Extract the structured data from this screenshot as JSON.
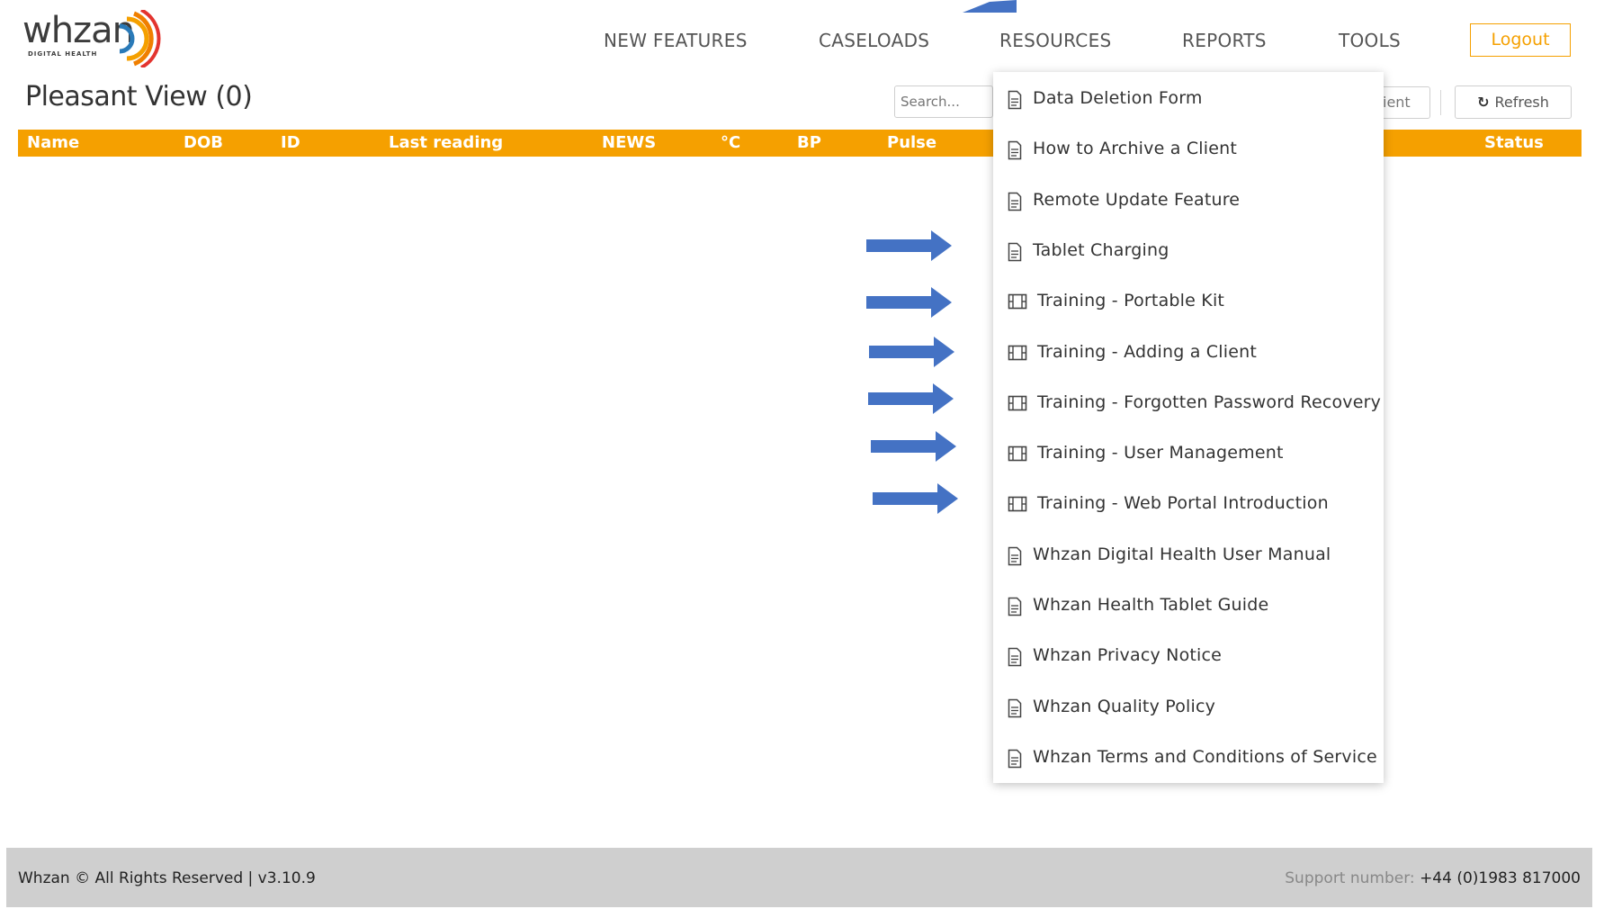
{
  "brand": {
    "name": "whzan",
    "tagline": "DIGITAL HEALTH",
    "colors": {
      "orange": "#f5a000",
      "arc_red": "#e3342f",
      "arc_amber": "#f5a000",
      "arrow_blue": "#4472c4"
    }
  },
  "nav": {
    "items": [
      {
        "label": "NEW FEATURES"
      },
      {
        "label": "CASELOADS"
      },
      {
        "label": "RESOURCES"
      },
      {
        "label": "REPORTS"
      },
      {
        "label": "TOOLS"
      }
    ],
    "logout_label": "Logout"
  },
  "page": {
    "title": "Pleasant View (0)",
    "search_placeholder": "Search...",
    "partial_button_label": "ient",
    "refresh_label": "Refresh",
    "refresh_icon": "refresh-icon"
  },
  "table": {
    "columns": [
      "Name",
      "DOB",
      "ID",
      "Last reading",
      "NEWS",
      "°C",
      "BP",
      "Pulse",
      "Status"
    ]
  },
  "resources_menu": {
    "items": [
      {
        "label": "Data Deletion Form",
        "icon": "document-icon"
      },
      {
        "label": "How to Archive a Client",
        "icon": "document-icon"
      },
      {
        "label": "Remote Update Feature",
        "icon": "document-icon"
      },
      {
        "label": "Tablet Charging",
        "icon": "document-icon"
      },
      {
        "label": "Training - Portable Kit",
        "icon": "film-icon"
      },
      {
        "label": "Training - Adding a Client",
        "icon": "film-icon"
      },
      {
        "label": "Training - Forgotten Password Recovery",
        "icon": "film-icon"
      },
      {
        "label": "Training - User Management",
        "icon": "film-icon"
      },
      {
        "label": "Training - Web Portal Introduction",
        "icon": "film-icon"
      },
      {
        "label": "Whzan Digital Health User Manual",
        "icon": "document-icon"
      },
      {
        "label": "Whzan Health Tablet Guide",
        "icon": "document-icon"
      },
      {
        "label": "Whzan Privacy Notice",
        "icon": "document-icon"
      },
      {
        "label": "Whzan Quality Policy",
        "icon": "document-icon"
      },
      {
        "label": "Whzan Terms and Conditions of Service",
        "icon": "document-icon"
      }
    ]
  },
  "footer": {
    "left_text": "Whzan © All Rights Reserved | v3.10.9",
    "support_label": "Support number:",
    "support_number": "+44 (0)1983 817000"
  }
}
